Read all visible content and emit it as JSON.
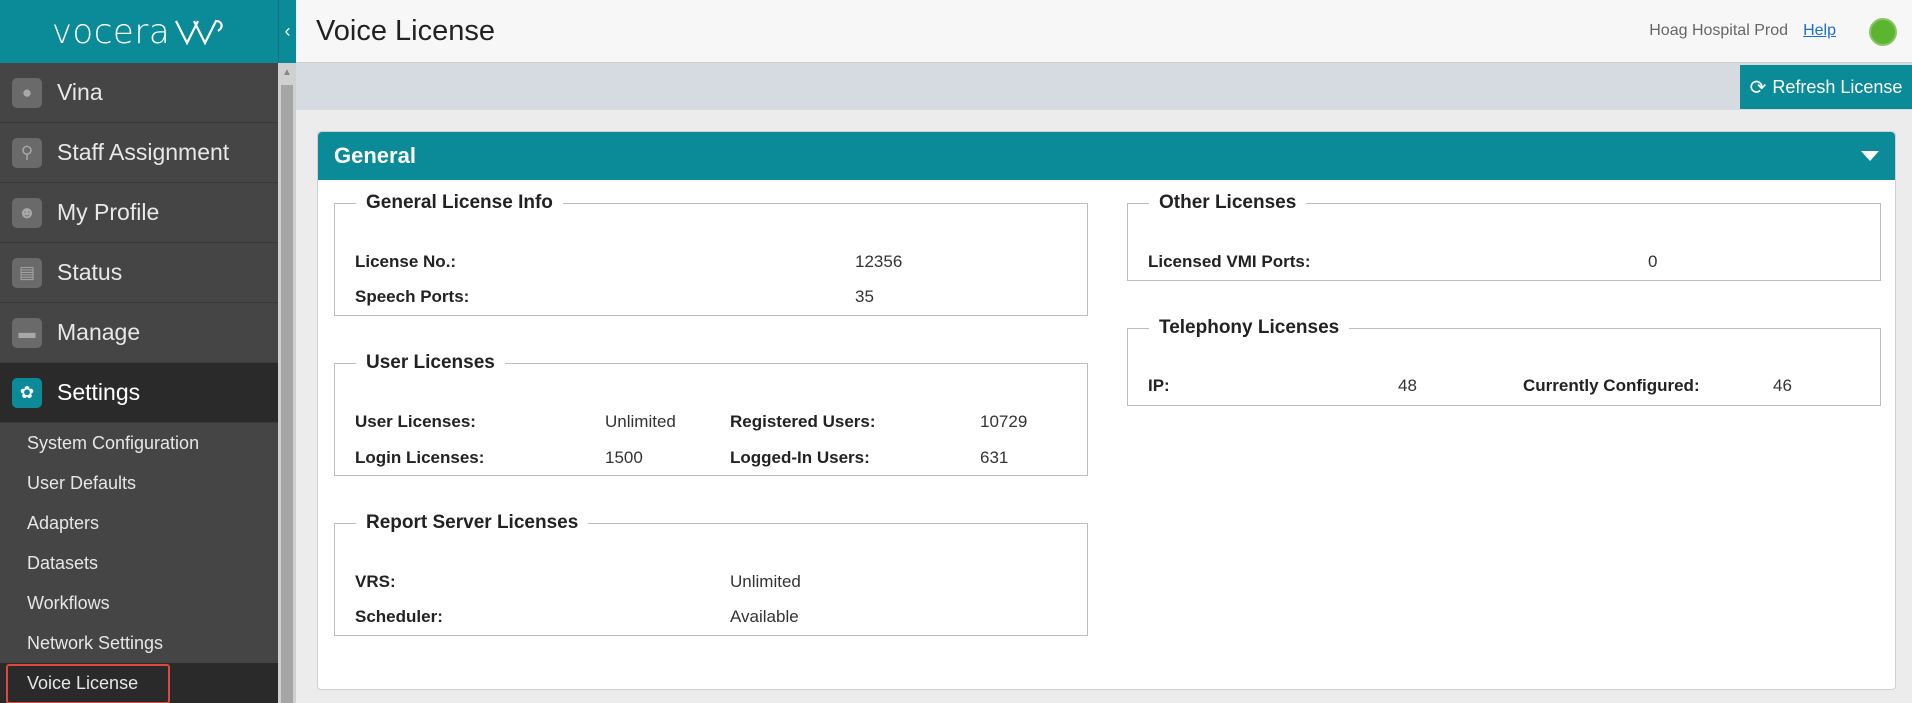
{
  "sidebar": {
    "logo": "vocera",
    "nav": [
      {
        "label": "Vina",
        "icon": "chat-icon"
      },
      {
        "label": "Staff Assignment",
        "icon": "people-icon"
      },
      {
        "label": "My Profile",
        "icon": "user-icon"
      },
      {
        "label": "Status",
        "icon": "status-icon"
      },
      {
        "label": "Manage",
        "icon": "briefcase-icon"
      },
      {
        "label": "Settings",
        "icon": "gear-icon"
      }
    ],
    "subnav": [
      "System Configuration",
      "User Defaults",
      "Adapters",
      "Datasets",
      "Workflows",
      "Network Settings",
      "Voice License"
    ]
  },
  "header": {
    "title": "Voice License",
    "site": "Hoag Hospital Prod",
    "help": "Help"
  },
  "toolbar": {
    "refresh": "Refresh License"
  },
  "panel": {
    "title": "General",
    "general_info": {
      "legend": "General License Info",
      "license_no_label": "License No.:",
      "license_no": "12356",
      "speech_ports_label": "Speech Ports:",
      "speech_ports": "35"
    },
    "user_licenses": {
      "legend": "User Licenses",
      "user_label": "User Licenses:",
      "user_value": "Unlimited",
      "registered_label": "Registered Users:",
      "registered_value": "10729",
      "login_label": "Login Licenses:",
      "login_value": "1500",
      "loggedin_label": "Logged-In Users:",
      "loggedin_value": "631"
    },
    "report_server": {
      "legend": "Report Server Licenses",
      "vrs_label": "VRS:",
      "vrs_value": "Unlimited",
      "scheduler_label": "Scheduler:",
      "scheduler_value": "Available"
    },
    "other": {
      "legend": "Other Licenses",
      "vmi_label": "Licensed VMI Ports:",
      "vmi_value": "0"
    },
    "telephony": {
      "legend": "Telephony Licenses",
      "ip_label": "IP:",
      "ip_value": "48",
      "configured_label": "Currently Configured:",
      "configured_value": "46"
    }
  },
  "colors": {
    "teal": "#0b8a97",
    "status_green": "#5cb531",
    "selected_outline": "#e0483d"
  }
}
